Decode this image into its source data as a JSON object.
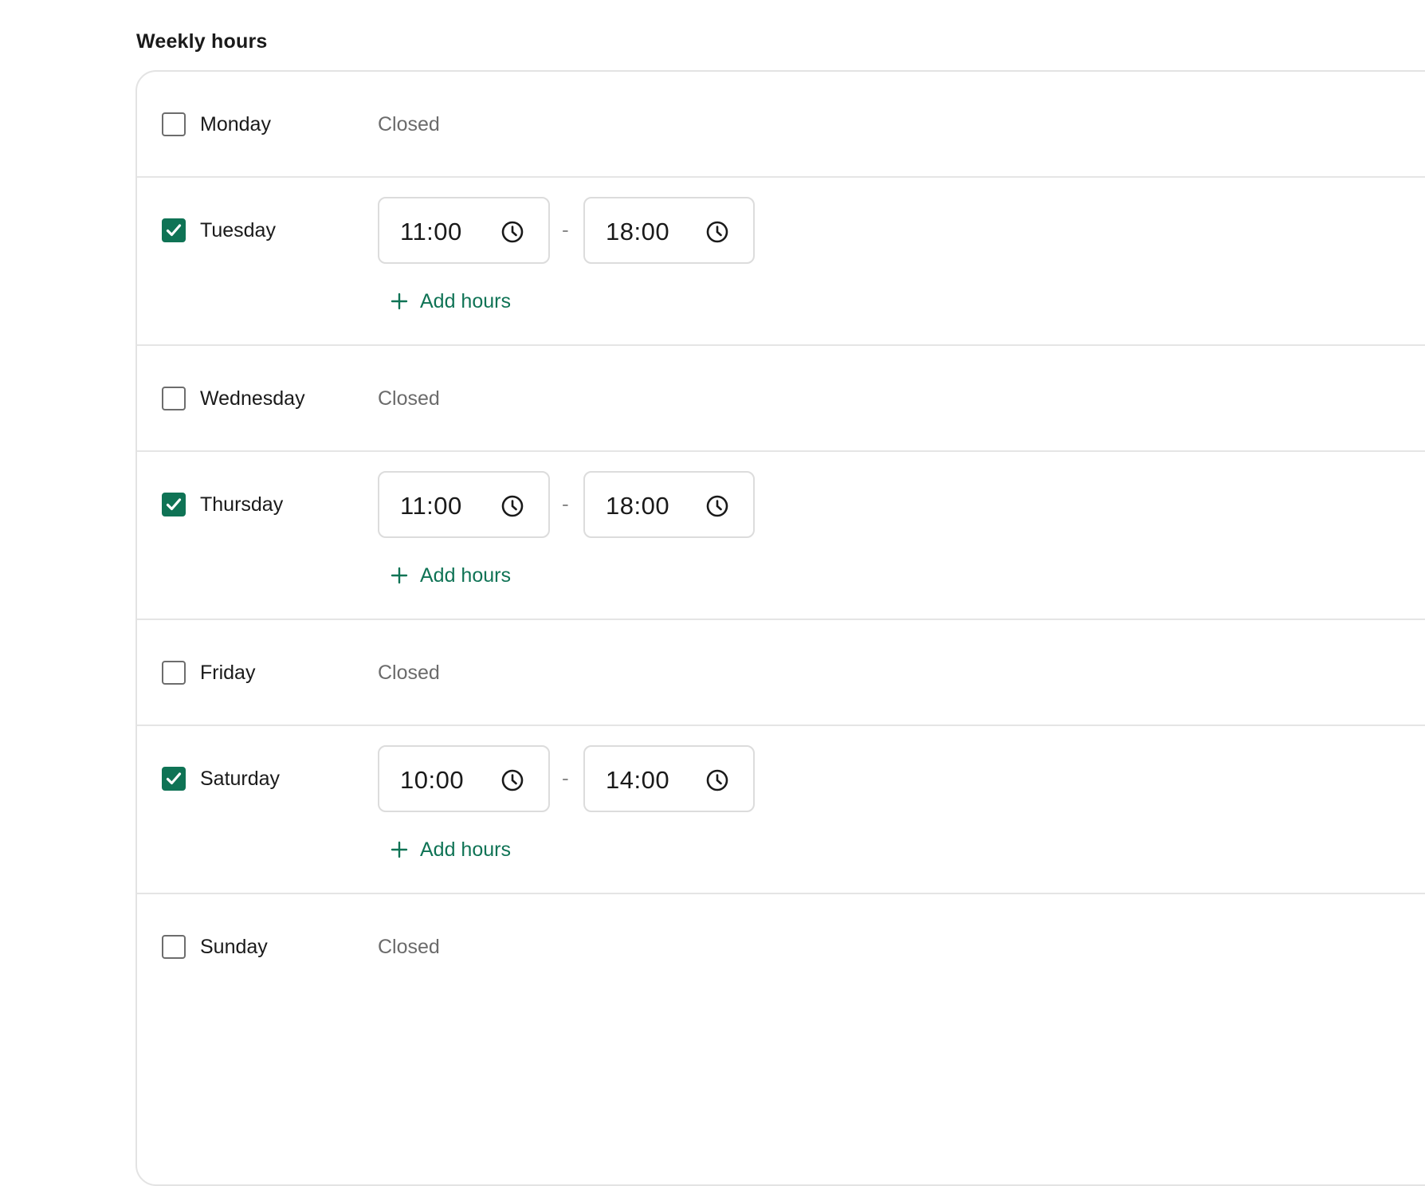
{
  "section": {
    "title": "Weekly hours"
  },
  "closed_label": "Closed",
  "add_hours_label": "Add hours",
  "separator": "-",
  "accent_color": "#0f7355",
  "days": [
    {
      "name": "Monday",
      "enabled": false
    },
    {
      "name": "Tuesday",
      "enabled": true,
      "start": "11:00",
      "end": "18:00"
    },
    {
      "name": "Wednesday",
      "enabled": false
    },
    {
      "name": "Thursday",
      "enabled": true,
      "start": "11:00",
      "end": "18:00"
    },
    {
      "name": "Friday",
      "enabled": false
    },
    {
      "name": "Saturday",
      "enabled": true,
      "start": "10:00",
      "end": "14:00"
    },
    {
      "name": "Sunday",
      "enabled": false
    }
  ],
  "icons": {
    "time_field": "clock-icon",
    "add": "plus-icon",
    "checked": "checkmark-icon"
  }
}
